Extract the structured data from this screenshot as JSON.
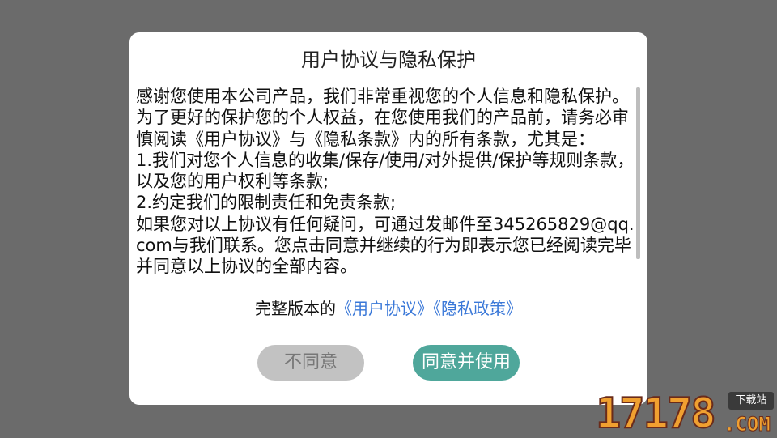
{
  "dialog": {
    "title": "用户协议与隐私保护",
    "body": "感谢您使用本公司产品，我们非常重视您的个人信息和隐私保护。为了更好的保护您的个人权益，在您使用我们的产品前，请务必审慎阅读《用户协议》与《隐私条款》内的所有条款，尤其是：\n1.我们对您个人信息的收集/保存/使用/对外提供/保护等规则条款，以及您的用户权利等条款;\n2.约定我们的限制责任和免责条款;\n如果您对以上协议有任何疑问，可通过发邮件至345265829@qq.com与我们联系。您点击同意并继续的行为即表示您已经阅读完毕并同意以上协议的全部内容。",
    "footer_prefix": "完整版本的",
    "link_user_agreement": "《用户协议》",
    "link_privacy_policy": "《隐私政策》",
    "disagree_label": "不同意",
    "agree_label": "同意并使用"
  },
  "watermark": {
    "number": "17178",
    "tag": "下载站",
    "domain": ".COM"
  },
  "colors": {
    "overlay": "#6b6b6b",
    "link": "#3a78d8",
    "agree_button": "#4fa79b",
    "disagree_button": "#c2c2c2"
  }
}
